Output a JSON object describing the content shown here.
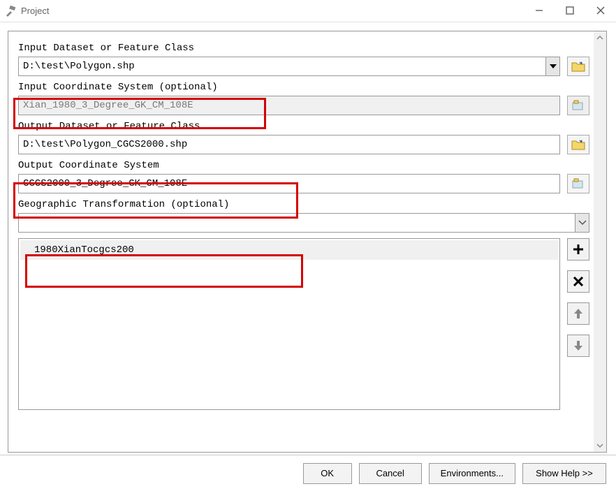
{
  "window": {
    "title": "Project"
  },
  "form": {
    "input_dataset": {
      "label": "Input Dataset or Feature Class",
      "value": "D:\\test\\Polygon.shp"
    },
    "input_cs": {
      "label": "Input Coordinate System (optional)",
      "value": "Xian_1980_3_Degree_GK_CM_108E"
    },
    "output_dataset": {
      "label": "Output Dataset or Feature Class",
      "value": "D:\\test\\Polygon_CGCS2000.shp"
    },
    "output_cs": {
      "label": "Output Coordinate System",
      "value": "CGCS2000_3_Degree_GK_CM_108E"
    },
    "geo_transform": {
      "label": "Geographic Transformation (optional)",
      "combo_value": "",
      "items": [
        "1980XianTocgcs200"
      ]
    }
  },
  "buttons": {
    "ok": "OK",
    "cancel": "Cancel",
    "environments": "Environments...",
    "show_help": "Show Help >>"
  }
}
